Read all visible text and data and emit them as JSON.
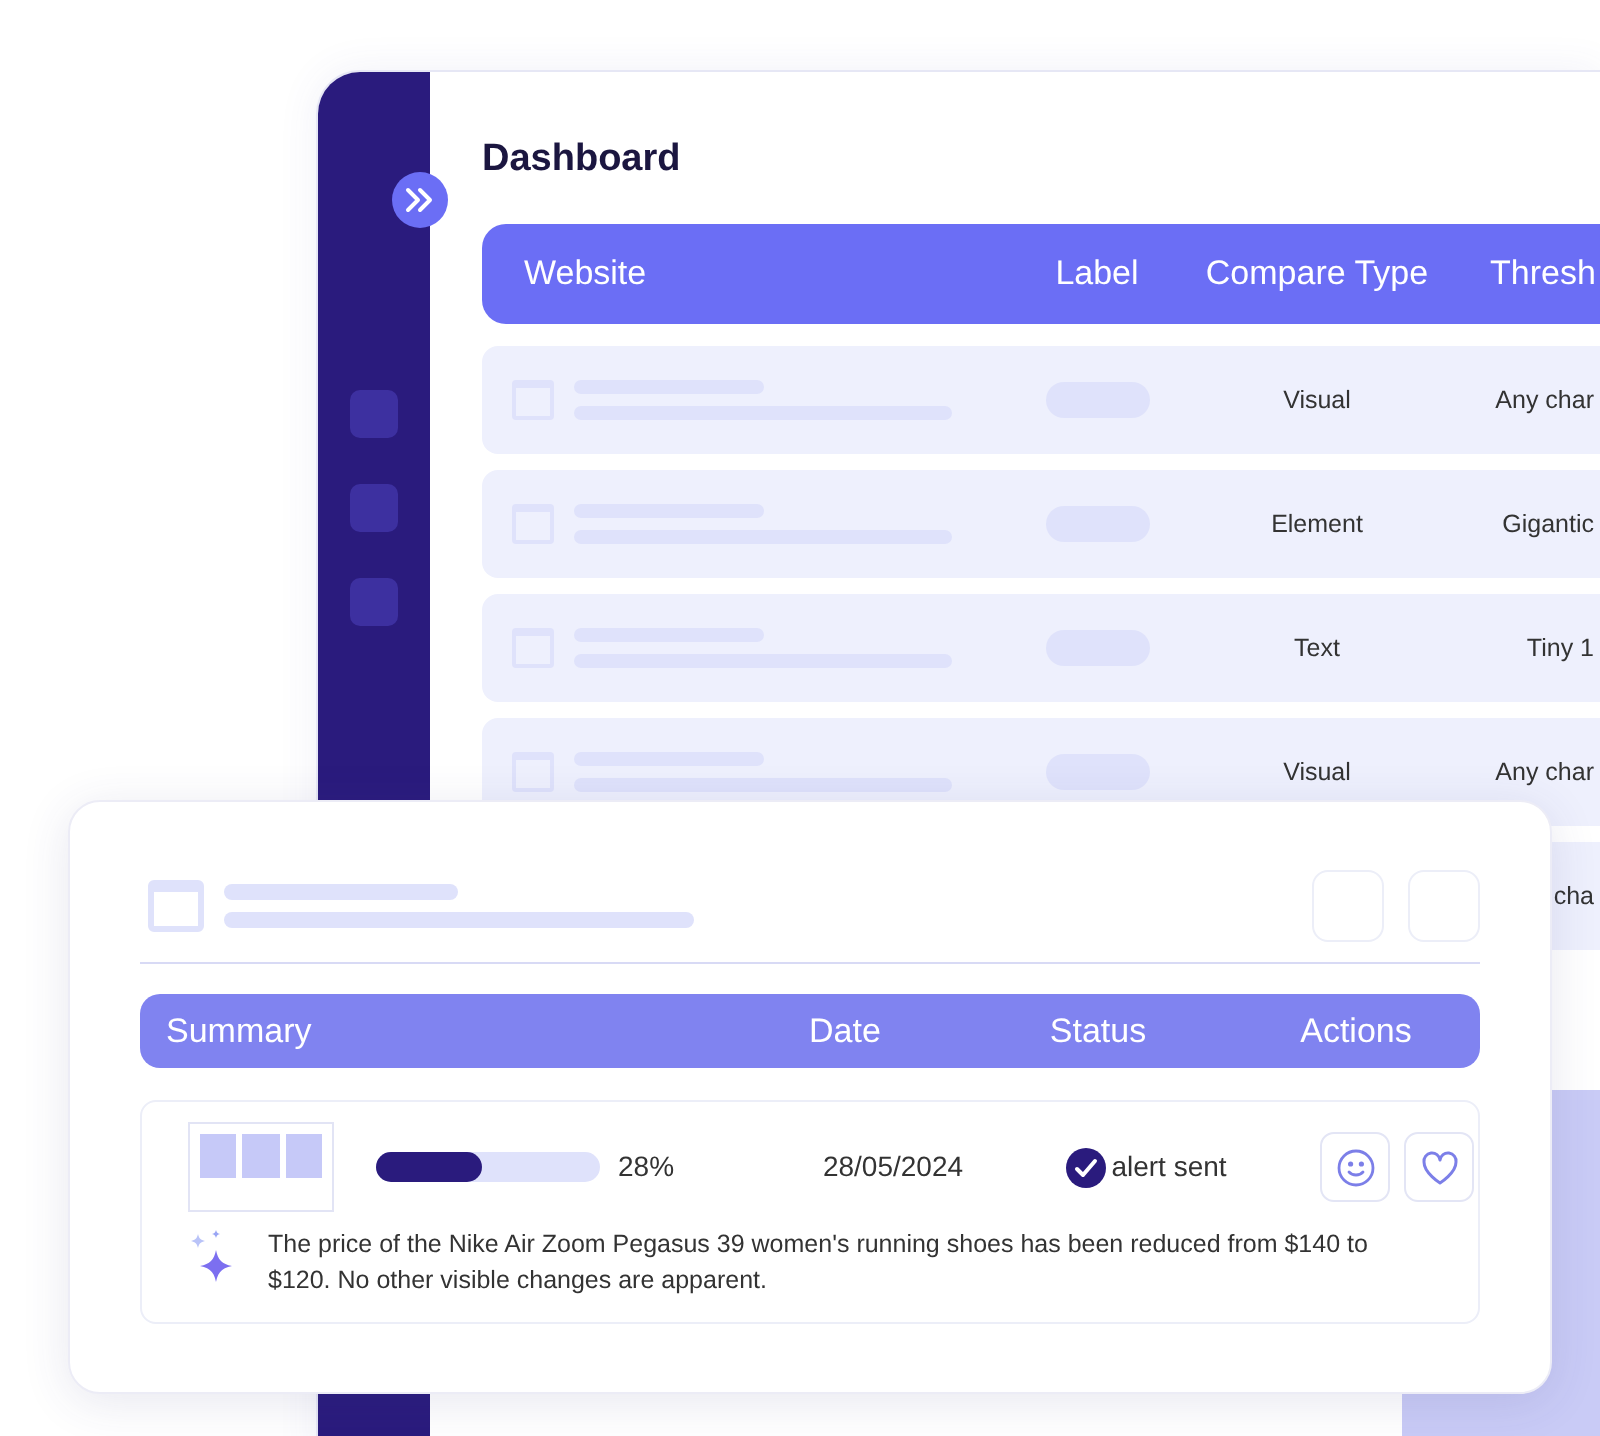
{
  "dashboard": {
    "title": "Dashboard",
    "columns": [
      "Website",
      "Label",
      "Compare Type",
      "Thresh"
    ],
    "rows": [
      {
        "compare_type": "Visual",
        "threshold": "Any char"
      },
      {
        "compare_type": "Element",
        "threshold": "Gigantic"
      },
      {
        "compare_type": "Text",
        "threshold": "Tiny 1"
      },
      {
        "compare_type": "Visual",
        "threshold": "Any char"
      },
      {
        "threshold": "cha"
      }
    ]
  },
  "alert_card": {
    "columns": [
      "Summary",
      "Date",
      "Status",
      "Actions"
    ],
    "row": {
      "level": 0.47,
      "percent": "28%",
      "date": "28/05/2024",
      "status": "alert sent",
      "description": "The price of the Nike Air Zoom Pegasus 39 women's running shoes has been reduced from $140 to $120. No other visible changes are apparent."
    }
  }
}
